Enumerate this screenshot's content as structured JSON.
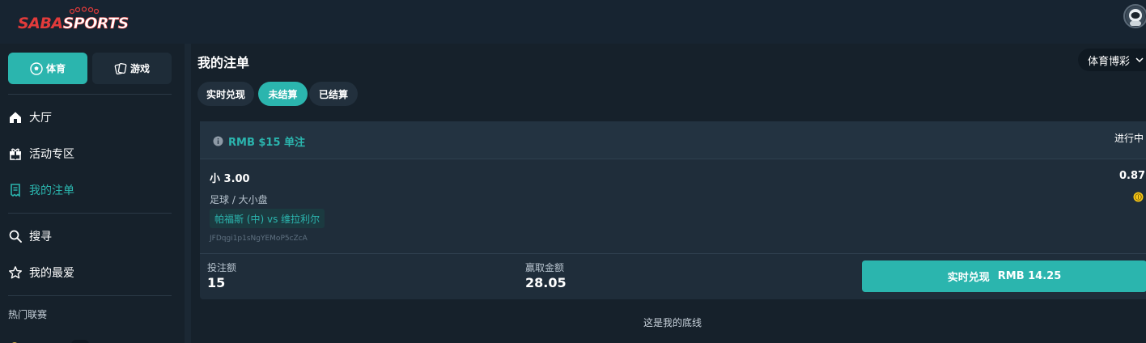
{
  "brand": {
    "logo_text_a": "SABA",
    "logo_text_b": "SPORTS"
  },
  "sidebar": {
    "sport_tabs": [
      {
        "label": "体育",
        "icon": "soccer-ball-icon",
        "active": true
      },
      {
        "label": "游戏",
        "icon": "cards-icon",
        "active": false
      }
    ],
    "items": [
      {
        "label": "大厅",
        "icon": "home-icon"
      },
      {
        "label": "活动专区",
        "icon": "gift-icon"
      },
      {
        "label": "我的注单",
        "icon": "receipt-icon",
        "active": true
      },
      {
        "label": "搜寻",
        "icon": "search-icon"
      },
      {
        "label": "我的最爱",
        "icon": "star-icon"
      }
    ],
    "section_heading": "热门联赛"
  },
  "main": {
    "title": "我的注单",
    "dropdown_label": "体育博彩",
    "tabs": [
      {
        "label": "实时兑现",
        "active": false
      },
      {
        "label": "未结算",
        "active": true
      },
      {
        "label": "已结算",
        "active": false
      }
    ],
    "bet_card": {
      "stake_title": "RMB $15 单注",
      "status": "进行中",
      "selection": "小  3.00",
      "odds": "0.87",
      "market": "足球 / 大小盘",
      "match": "帕福斯 (中) vs 维拉利尔",
      "bet_id": "JFDqgi1p1sNgYEMoP5cZcA",
      "stake_label": "投注额",
      "stake_value": "15",
      "win_label": "赢取金额",
      "win_value": "28.05",
      "cashout_label": "实时兑现",
      "cashout_value": "RMB 14.25"
    },
    "footer_note": "这是我的底线"
  },
  "colors": {
    "accent": "#2bb5ae",
    "background": "#16212b",
    "card": "#1f2d3a",
    "coin": "#f5c518"
  }
}
